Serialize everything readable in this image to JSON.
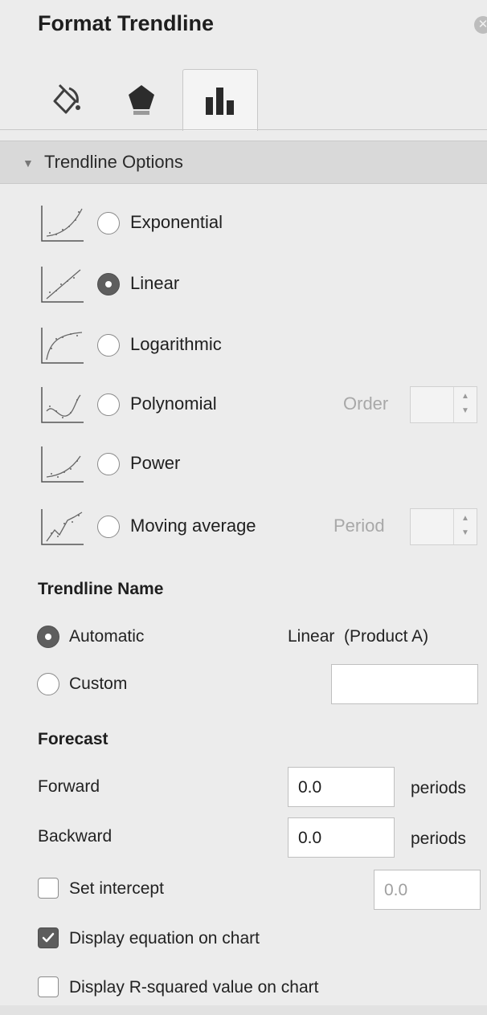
{
  "panel": {
    "title": "Format Trendline",
    "close_icon": "close-circle-icon",
    "tabs": [
      {
        "icon": "fill-bucket-icon",
        "active": false
      },
      {
        "icon": "pentagon-shape-icon",
        "active": false
      },
      {
        "icon": "bar-chart-icon",
        "active": true
      }
    ]
  },
  "trendline_options": {
    "header": "Trendline Options",
    "types": [
      {
        "label": "Exponential",
        "icon": "exponential-trend-icon",
        "selected": false
      },
      {
        "label": "Linear",
        "icon": "linear-trend-icon",
        "selected": true
      },
      {
        "label": "Logarithmic",
        "icon": "logarithmic-trend-icon",
        "selected": false
      },
      {
        "label": "Polynomial",
        "icon": "polynomial-trend-icon",
        "selected": false,
        "extra_label": "Order",
        "extra_value": ""
      },
      {
        "label": "Power",
        "icon": "power-trend-icon",
        "selected": false
      },
      {
        "label": "Moving average",
        "icon": "moving-average-trend-icon",
        "selected": false,
        "extra_label": "Period",
        "extra_value": ""
      }
    ]
  },
  "trendline_name": {
    "heading": "Trendline Name",
    "automatic_label": "Automatic",
    "automatic_value": "Linear  (Product A)",
    "automatic_selected": true,
    "custom_label": "Custom",
    "custom_value": ""
  },
  "forecast": {
    "heading": "Forecast",
    "forward_label": "Forward",
    "forward_value": "0.0",
    "forward_unit": "periods",
    "backward_label": "Backward",
    "backward_value": "0.0",
    "backward_unit": "periods"
  },
  "checks": {
    "set_intercept_label": "Set intercept",
    "set_intercept_checked": false,
    "set_intercept_value": "0.0",
    "display_equation_label": "Display equation on chart",
    "display_equation_checked": true,
    "display_r_squared_label": "Display R-squared value on chart",
    "display_r_squared_checked": false
  }
}
